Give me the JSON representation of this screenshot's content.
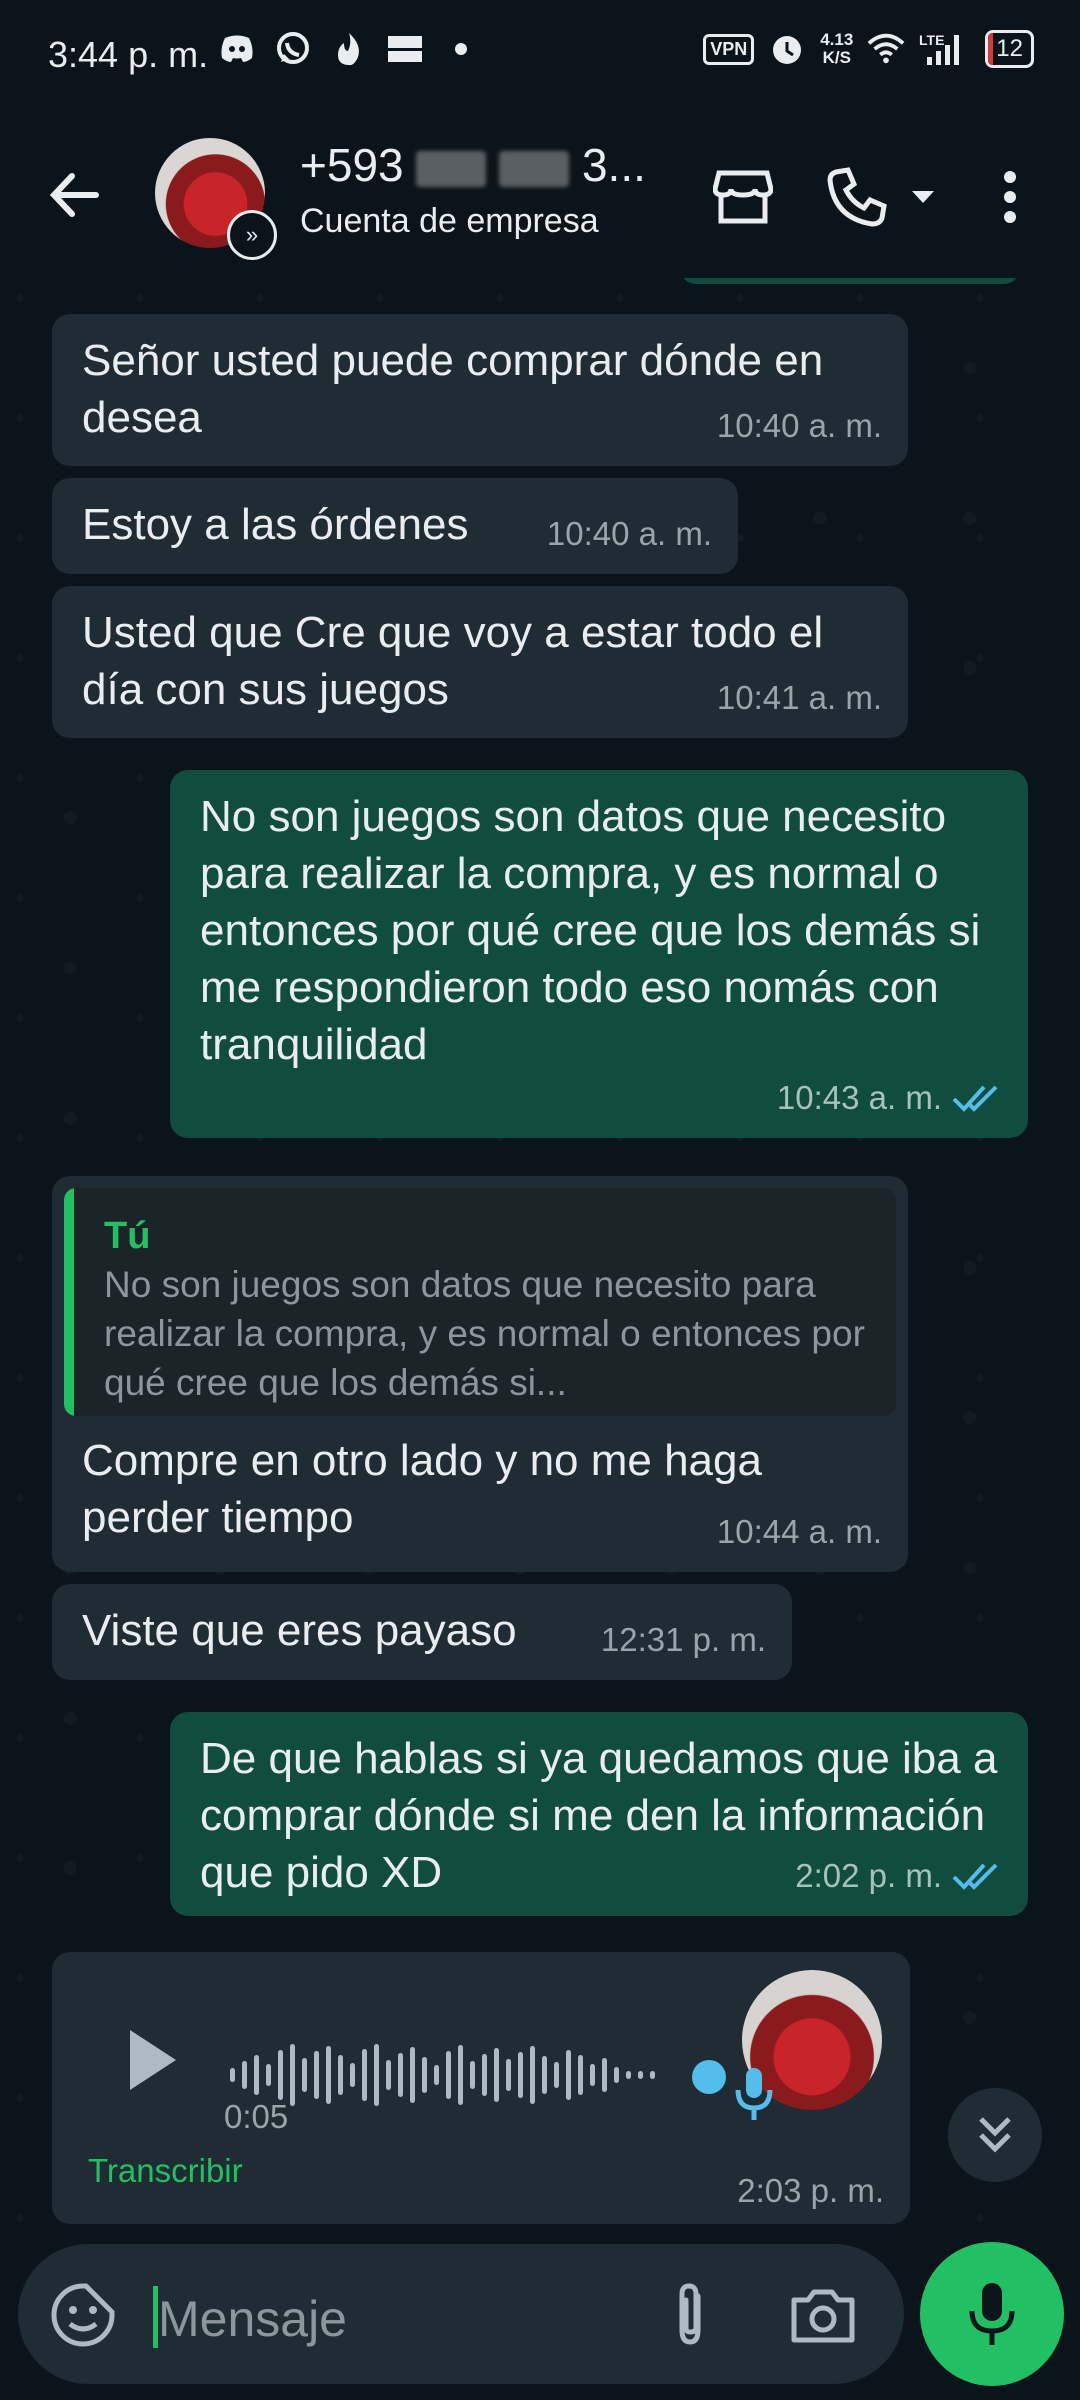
{
  "status_bar": {
    "time": "3:44 p. m.",
    "vpn": "VPN",
    "speed_value": "4.13",
    "speed_unit": "K/S",
    "network": "LTE",
    "battery": "12",
    "battery_level_percent": 12
  },
  "header": {
    "contact_prefix": "+593",
    "contact_suffix": "3...",
    "subtitle": "Cuenta de empresa"
  },
  "messages": [
    {
      "dir": "in",
      "text": "Señor usted puede comprar dónde en desea",
      "time": "10:40 a. m."
    },
    {
      "dir": "in",
      "text": "Estoy a las órdenes",
      "time": "10:40 a. m."
    },
    {
      "dir": "in",
      "text": "Usted que Cre que voy a estar todo el día con sus juegos",
      "time": "10:41 a. m."
    },
    {
      "dir": "out",
      "text": "No son juegos son datos que necesito para realizar la compra, y es normal o entonces por qué cree que los demás si me respondieron todo eso nomás con tranquilidad",
      "time": "10:43 a. m."
    },
    {
      "dir": "in",
      "quote_author": "Tú",
      "quote_text": "No son juegos son datos que necesito para realizar la compra, y es normal o entonces por qué cree que los demás si...",
      "text": "Compre en otro lado y no me haga perder tiempo",
      "time": "10:44 a. m."
    },
    {
      "dir": "in",
      "text": "Viste que eres payaso",
      "time": "12:31 p. m."
    },
    {
      "dir": "out",
      "text": "De que hablas si ya quedamos que iba a comprar dónde si me den la información que pido XD",
      "time": "2:02 p. m."
    }
  ],
  "audio": {
    "duration": "0:05",
    "transcribe": "Transcribir",
    "time": "2:03 p. m.",
    "progress": 0
  },
  "input": {
    "placeholder": "Mensaje"
  },
  "colors": {
    "background": "#0b141a",
    "incoming_bubble": "#202c33",
    "outgoing_bubble": "#114d3e",
    "accent": "#21c063",
    "read_ticks": "#53bdeb"
  }
}
